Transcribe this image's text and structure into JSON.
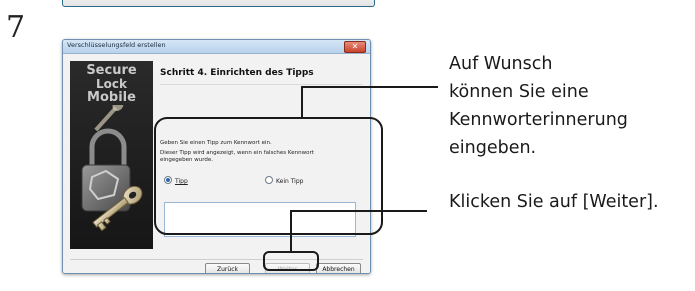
{
  "step_number": "7",
  "dialog": {
    "title": "Verschlüsselungsfeld erstellen",
    "close_glyph": "✕",
    "sidebar": {
      "line1": "Secure",
      "line2": "Lock",
      "line3": "Mobile"
    },
    "heading": "Schritt 4. Einrichten des Tipps",
    "label_enter_hint": "Geben Sie einen Tipp zum Kennwort ein.",
    "label_hint_info": "Dieser Tipp wird angezeigt, wenn ein falsches Kennwort eingegeben wurde.",
    "radio_tipp": "Tipp",
    "radio_kein_tipp": "Kein Tipp",
    "hint_value": "",
    "buttons": {
      "back": "Zurück",
      "next": "Weiter",
      "cancel": "Abbrechen"
    }
  },
  "annotations": {
    "line1": "Auf Wunsch",
    "line2": "können Sie eine",
    "line3": "Kennworterinnerung",
    "line4": "eingeben.",
    "click_next": "Klicken Sie auf [Weiter]."
  }
}
